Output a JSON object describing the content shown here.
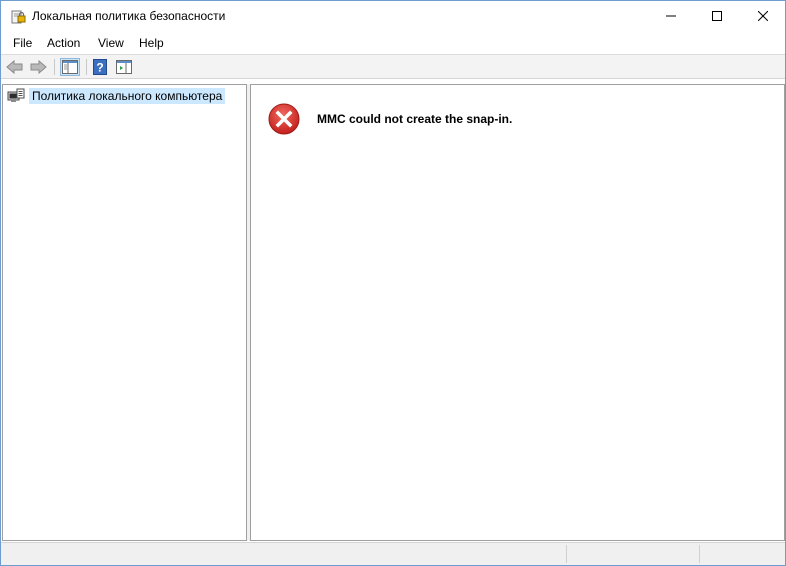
{
  "window": {
    "title": "Локальная политика безопасности"
  },
  "menu": {
    "file": "File",
    "action": "Action",
    "view": "View",
    "help": "Help"
  },
  "tree": {
    "root_label": "Политика локального компьютера"
  },
  "main": {
    "error_message": "MMC could not create the snap-in."
  },
  "colors": {
    "selection": "#cce8ff",
    "error_red": "#d9302e",
    "border_accent": "#6f9ccf"
  },
  "icons": {
    "app": "security-policy-icon",
    "tree_root": "computer-policy-icon",
    "error": "error-icon"
  }
}
